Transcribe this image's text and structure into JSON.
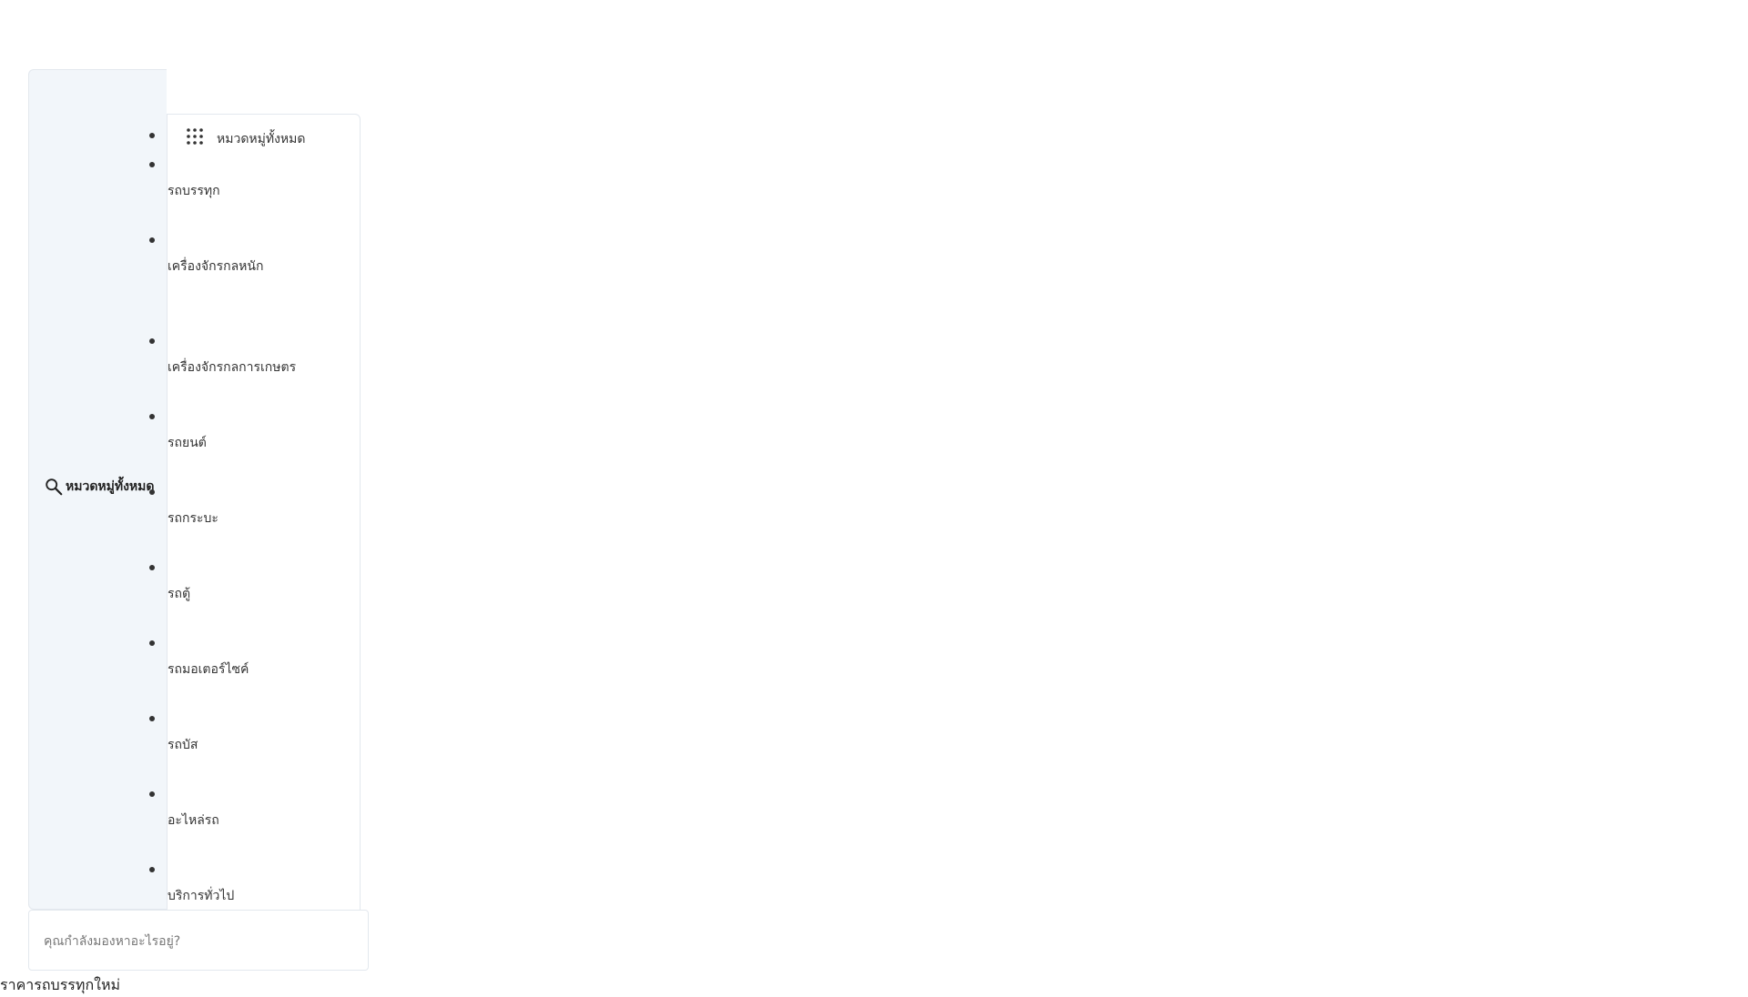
{
  "side_toggle": {
    "icon": "search-icon",
    "label": "หมวดหมู่ทั้งหมด"
  },
  "dropdown": {
    "header_icon": "grid-icon",
    "header_label": "หมวดหมู่ทั้งหมด",
    "items": [
      "รถบรรทุก",
      "เครื่องจักรกลหนัก",
      "เครื่องจักรกลการเกษตร",
      "รถยนต์",
      "รถกระบะ",
      "รถตู้",
      "รถมอเตอร์ไซค์",
      "รถบัส",
      "อะไหล่รถ",
      "บริการทั่วไป"
    ]
  },
  "search": {
    "placeholder": "คุณกำลังมองหาอะไรอยู่?",
    "value": ""
  },
  "footer": {
    "text": "ราคารถบรรทุกใหม่"
  }
}
